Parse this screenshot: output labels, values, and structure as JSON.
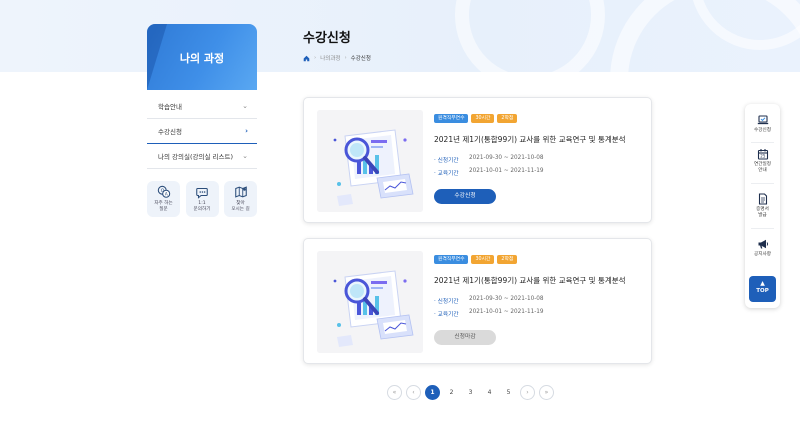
{
  "page": {
    "title": "수강신청"
  },
  "breadcrumb": {
    "home": "home-icon",
    "items": [
      "나의과정",
      "수강신청"
    ]
  },
  "sidebar": {
    "title": "나의 과정",
    "items": [
      {
        "label": "학습안내",
        "chevron": "⌄"
      },
      {
        "label": "수강신청",
        "chevron": "›"
      },
      {
        "label": "나의 강의실(강의실 리스트)",
        "chevron": "⌄"
      }
    ],
    "quick": [
      {
        "label": "자주 하는\n질문",
        "icon": "faq-icon"
      },
      {
        "label": "1:1\n문의하기",
        "icon": "chat-icon"
      },
      {
        "label": "찾아\n오시는 길",
        "icon": "map-icon"
      }
    ]
  },
  "courses": [
    {
      "badges": [
        "원격직무연수",
        "30시간",
        "2학점"
      ],
      "title": "2021년 제1기(통합99기) 교사를 위한 교육연구 및 통계분석",
      "apply_label": "신청기간",
      "apply_period": "2021-09-30 ~ 2021-10-08",
      "edu_label": "교육기간",
      "edu_period": "2021-10-01 ~ 2021-11-19",
      "button": "수강신청",
      "button_state": "active"
    },
    {
      "badges": [
        "원격직무연수",
        "30시간",
        "2학점"
      ],
      "title": "2021년 제1기(통합99기) 교사를 위한 교육연구 및 통계분석",
      "apply_label": "신청기간",
      "apply_period": "2021-09-30 ~ 2021-10-08",
      "edu_label": "교육기간",
      "edu_period": "2021-10-01 ~ 2021-11-19",
      "button": "신청마감",
      "button_state": "disabled"
    }
  ],
  "pagination": {
    "first": "«",
    "prev": "‹",
    "pages": [
      "1",
      "2",
      "3",
      "4",
      "5"
    ],
    "current": "1",
    "next": "›",
    "last": "»"
  },
  "right_menu": {
    "items": [
      {
        "label": "수강신청",
        "icon": "laptop-icon"
      },
      {
        "label": "연간일정\n안내",
        "icon": "calendar-icon"
      },
      {
        "label": "증명서\n발급",
        "icon": "document-icon"
      },
      {
        "label": "공지사항",
        "icon": "megaphone-icon"
      }
    ],
    "top_arrow": "▲",
    "top_label": "TOP"
  },
  "colors": {
    "primary": "#1e5fb9",
    "badge_blue": "#3a8de0",
    "badge_orange": "#f2a532",
    "disabled": "#dadada"
  }
}
